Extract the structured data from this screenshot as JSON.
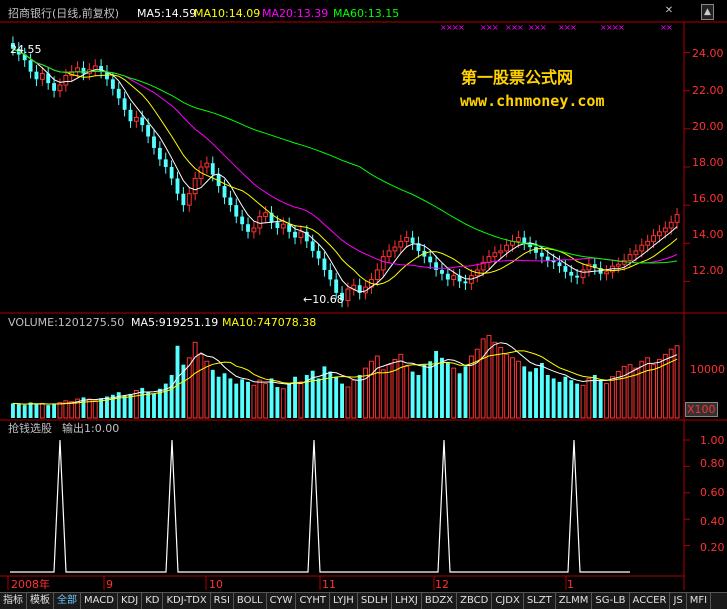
{
  "header": {
    "stock": "招商银行(日线,前复权)",
    "ma5": "MA5:14.59",
    "ma10": "MA10:14.09",
    "ma20": "MA20:13.39",
    "ma60": "MA60:13.15"
  },
  "colors": {
    "ma5": "#ffffff",
    "ma10": "#ffff00",
    "ma20": "#ff00ff",
    "ma60": "#00ff00",
    "up": "#ff3232",
    "down": "#54ffff",
    "axis": "#b00000",
    "watermark": "#ffd200"
  },
  "watermark": {
    "line1": "第一股票公式网",
    "line2": "www.chnmoney.com"
  },
  "price_axis": {
    "ticks": [
      "24.00",
      "22.00",
      "20.00",
      "18.00",
      "16.00",
      "14.00",
      "12.00"
    ]
  },
  "price_labels": {
    "high": "24.55",
    "low": "←10.68"
  },
  "volume": {
    "header_main": "VOLUME:1201275.50",
    "header_ma5": "MA5:919251.19",
    "header_ma10": "MA10:747078.38",
    "axis_tick": "10000",
    "unit": "X100"
  },
  "indicator": {
    "name": "抢钱选股",
    "output": "输出1:0.00",
    "ticks": [
      "1.00",
      "0.80",
      "0.60",
      "0.40",
      "0.20"
    ]
  },
  "time_axis": {
    "labels": [
      "2008年",
      "9",
      "10",
      "11",
      "12",
      "1"
    ]
  },
  "tabs": [
    {
      "label": "指标",
      "sel": false,
      "blue": false
    },
    {
      "label": "模板",
      "sel": false,
      "blue": false
    },
    {
      "label": "全部",
      "sel": false,
      "blue": true
    },
    {
      "label": "MACD",
      "sel": false,
      "blue": false
    },
    {
      "label": "KDJ",
      "sel": false,
      "blue": false
    },
    {
      "label": "KD",
      "sel": false,
      "blue": false
    },
    {
      "label": "KDJ-TDX",
      "sel": false,
      "blue": false
    },
    {
      "label": "RSI",
      "sel": false,
      "blue": false
    },
    {
      "label": "BOLL",
      "sel": false,
      "blue": false
    },
    {
      "label": "CYW",
      "sel": false,
      "blue": false
    },
    {
      "label": "CYHT",
      "sel": false,
      "blue": false
    },
    {
      "label": "LYJH",
      "sel": false,
      "blue": false
    },
    {
      "label": "SDLH",
      "sel": false,
      "blue": false
    },
    {
      "label": "LHXJ",
      "sel": false,
      "blue": false
    },
    {
      "label": "BDZX",
      "sel": false,
      "blue": false
    },
    {
      "label": "ZBCD",
      "sel": false,
      "blue": false
    },
    {
      "label": "CJDX",
      "sel": false,
      "blue": false
    },
    {
      "label": "SLZT",
      "sel": false,
      "blue": false
    },
    {
      "label": "ZLMM",
      "sel": false,
      "blue": false
    },
    {
      "label": "SG-LB",
      "sel": false,
      "blue": false
    },
    {
      "label": "ACCER",
      "sel": false,
      "blue": false
    },
    {
      "label": "JS",
      "sel": false,
      "blue": false
    },
    {
      "label": "MFI",
      "sel": false,
      "blue": false
    }
  ],
  "chart_data": {
    "type": "line",
    "price_closes": [
      24.2,
      23.9,
      23.6,
      23.0,
      22.6,
      22.9,
      22.4,
      22.0,
      22.3,
      22.8,
      23.0,
      23.2,
      22.9,
      23.1,
      23.3,
      23.0,
      22.6,
      22.1,
      21.6,
      21.0,
      20.4,
      20.6,
      20.2,
      19.6,
      19.0,
      18.4,
      18.0,
      17.4,
      16.6,
      16.0,
      16.6,
      17.4,
      18.0,
      18.2,
      17.6,
      17.0,
      16.4,
      16.0,
      15.4,
      15.0,
      14.6,
      14.8,
      15.4,
      15.6,
      15.1,
      14.8,
      15.0,
      14.6,
      14.3,
      14.6,
      14.1,
      13.6,
      13.2,
      12.6,
      12.1,
      11.4,
      11.0,
      11.6,
      11.8,
      11.4,
      11.7,
      12.1,
      12.6,
      13.3,
      13.6,
      13.8,
      14.1,
      14.3,
      14.0,
      13.6,
      13.3,
      13.0,
      12.6,
      12.4,
      12.1,
      12.3,
      12.0,
      11.9,
      12.3,
      12.6,
      13.0,
      13.3,
      13.5,
      13.6,
      13.9,
      14.1,
      14.3,
      14.0,
      13.8,
      13.5,
      13.3,
      13.1,
      13.0,
      12.8,
      12.5,
      12.3,
      12.2,
      12.6,
      12.9,
      12.7,
      12.4,
      12.5,
      12.8,
      12.9,
      13.1,
      13.4,
      13.6,
      13.9,
      14.1,
      14.4,
      14.6,
      14.8,
      15.1,
      15.5
    ],
    "price_ylim": [
      10.5,
      25.5
    ],
    "volume_ratio": [
      0.17,
      0.16,
      0.15,
      0.18,
      0.16,
      0.17,
      0.15,
      0.16,
      0.18,
      0.2,
      0.19,
      0.22,
      0.24,
      0.22,
      0.2,
      0.23,
      0.25,
      0.27,
      0.3,
      0.26,
      0.28,
      0.32,
      0.35,
      0.3,
      0.28,
      0.34,
      0.4,
      0.5,
      0.84,
      0.62,
      0.7,
      0.88,
      0.74,
      0.66,
      0.56,
      0.48,
      0.52,
      0.46,
      0.4,
      0.45,
      0.42,
      0.38,
      0.44,
      0.4,
      0.46,
      0.36,
      0.34,
      0.4,
      0.48,
      0.42,
      0.5,
      0.55,
      0.46,
      0.6,
      0.54,
      0.48,
      0.4,
      0.36,
      0.44,
      0.5,
      0.58,
      0.66,
      0.72,
      0.56,
      0.62,
      0.68,
      0.74,
      0.6,
      0.54,
      0.5,
      0.62,
      0.66,
      0.78,
      0.7,
      0.64,
      0.58,
      0.52,
      0.6,
      0.72,
      0.8,
      0.92,
      0.96,
      0.88,
      0.82,
      0.74,
      0.7,
      0.66,
      0.6,
      0.54,
      0.58,
      0.64,
      0.5,
      0.46,
      0.42,
      0.48,
      0.44,
      0.4,
      0.38,
      0.46,
      0.5,
      0.44,
      0.4,
      0.48,
      0.54,
      0.6,
      0.62,
      0.58,
      0.66,
      0.7,
      0.62,
      0.68,
      0.74,
      0.8,
      0.84
    ],
    "signal_indices": [
      14,
      49,
      80,
      116,
      148
    ]
  }
}
